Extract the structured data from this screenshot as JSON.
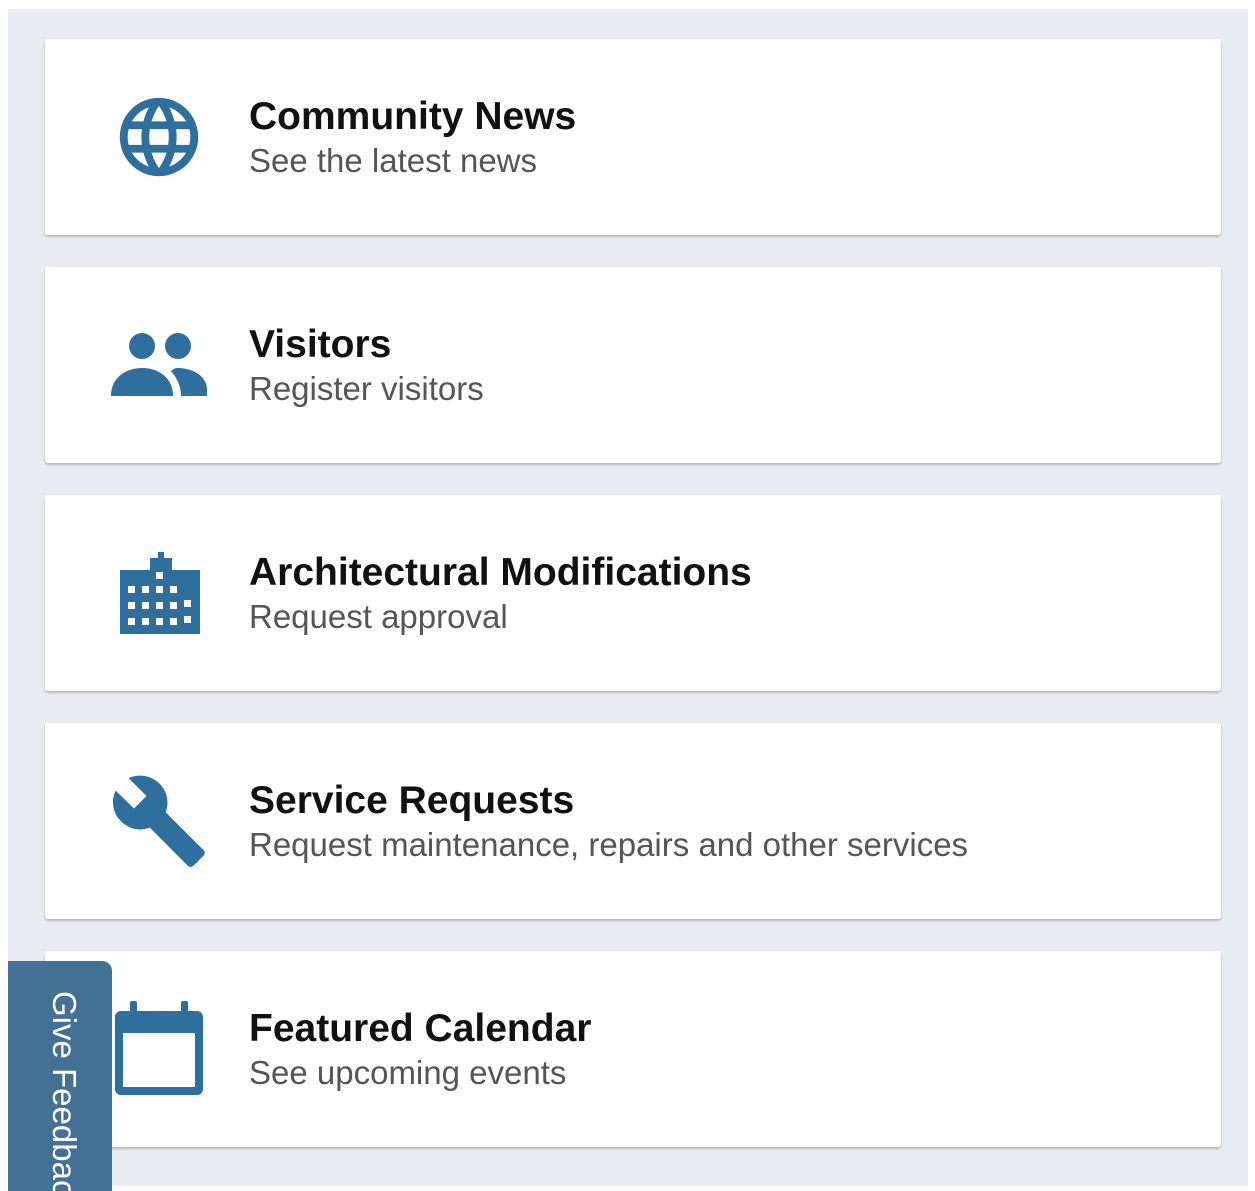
{
  "theme": {
    "accent": "#2e6f9e",
    "background": "#e9edf1",
    "card": "#ffffff",
    "feedback_tab": "#427195"
  },
  "cards": [
    {
      "icon": "globe-icon",
      "title": "Community News",
      "subtitle": "See the latest news"
    },
    {
      "icon": "people-icon",
      "title": "Visitors",
      "subtitle": "Register visitors"
    },
    {
      "icon": "building-icon",
      "title": "Architectural Modifications",
      "subtitle": "Request approval"
    },
    {
      "icon": "wrench-icon",
      "title": "Service Requests",
      "subtitle": "Request maintenance, repairs and other services"
    },
    {
      "icon": "calendar-icon",
      "title": "Featured Calendar",
      "subtitle": "See upcoming events"
    }
  ],
  "feedback": {
    "label": "Give Feedback"
  }
}
